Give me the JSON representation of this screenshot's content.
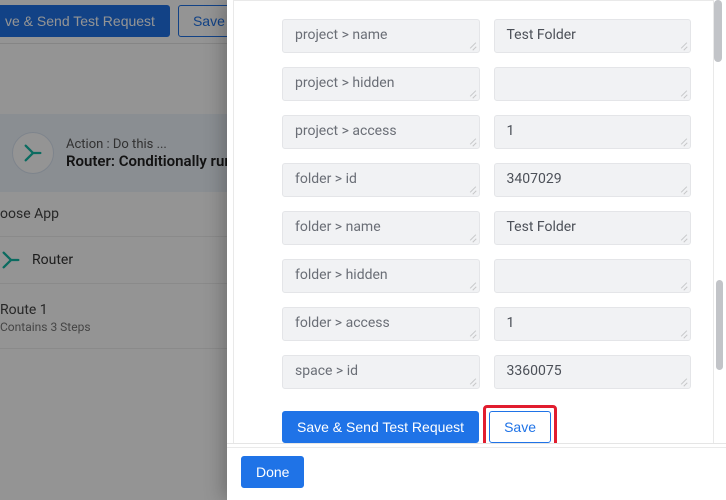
{
  "bg": {
    "send_test_label": "ve & Send Test Request",
    "save_label": "Save",
    "action_pretitle": "Action : Do this ...",
    "action_title": "Router: Conditionally run",
    "choose_app_label": "oose App",
    "app_name": "Router",
    "route_title": "Route 1",
    "route_sub": "Contains 3 Steps"
  },
  "modal": {
    "fields": [
      {
        "key": "project > name",
        "value": "Test Folder"
      },
      {
        "key": "project > hidden",
        "value": ""
      },
      {
        "key": "project > access",
        "value": "1"
      },
      {
        "key": "folder > id",
        "value": "3407029"
      },
      {
        "key": "folder > name",
        "value": "Test Folder"
      },
      {
        "key": "folder > hidden",
        "value": ""
      },
      {
        "key": "folder > access",
        "value": "1"
      },
      {
        "key": "space > id",
        "value": "3360075"
      }
    ],
    "send_test_label": "Save & Send Test Request",
    "save_label": "Save",
    "done_label": "Done"
  }
}
